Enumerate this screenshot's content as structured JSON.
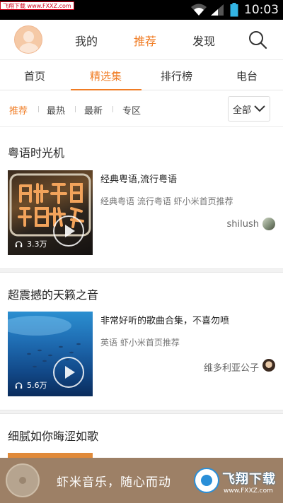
{
  "status_bar": {
    "watermark": "飞翔下载 www.FXXZ.com",
    "time": "10:03"
  },
  "header": {
    "tabs": [
      {
        "label": "我的"
      },
      {
        "label": "推荐"
      },
      {
        "label": "发现"
      }
    ],
    "active_tab": "推荐"
  },
  "subtabs": {
    "items": [
      {
        "label": "首页"
      },
      {
        "label": "精选集"
      },
      {
        "label": "排行榜"
      },
      {
        "label": "电台"
      }
    ],
    "active": "精选集"
  },
  "filters": {
    "items": [
      {
        "label": "推荐"
      },
      {
        "label": "最热"
      },
      {
        "label": "最新"
      },
      {
        "label": "专区"
      }
    ],
    "active": "推荐",
    "dropdown_value": "全部"
  },
  "collections": [
    {
      "title": "粤语时光机",
      "description": "经典粤语,流行粤语",
      "tags": "经典粤语 流行粤语 虾小米首页推荐",
      "author": "shilush",
      "plays": "3.3万"
    },
    {
      "title": "超震撼的天籁之音",
      "description": "非常好听的歌曲合集，不喜勿喷",
      "tags": "英语 虾小米首页推荐",
      "author": "维多利亚公子",
      "plays": "5.6万"
    },
    {
      "title": "细腻如你晦涩如歌",
      "description": "",
      "tags": "",
      "author": "",
      "plays": ""
    }
  ],
  "bottom_banner": {
    "slogan": "虾米音乐，随心而动",
    "watermark_text": "飞翔下载",
    "watermark_url": "www.FXXZ.com"
  },
  "colors": {
    "accent": "#f07c24",
    "status_bar": "#000000",
    "banner": "#96765a"
  }
}
